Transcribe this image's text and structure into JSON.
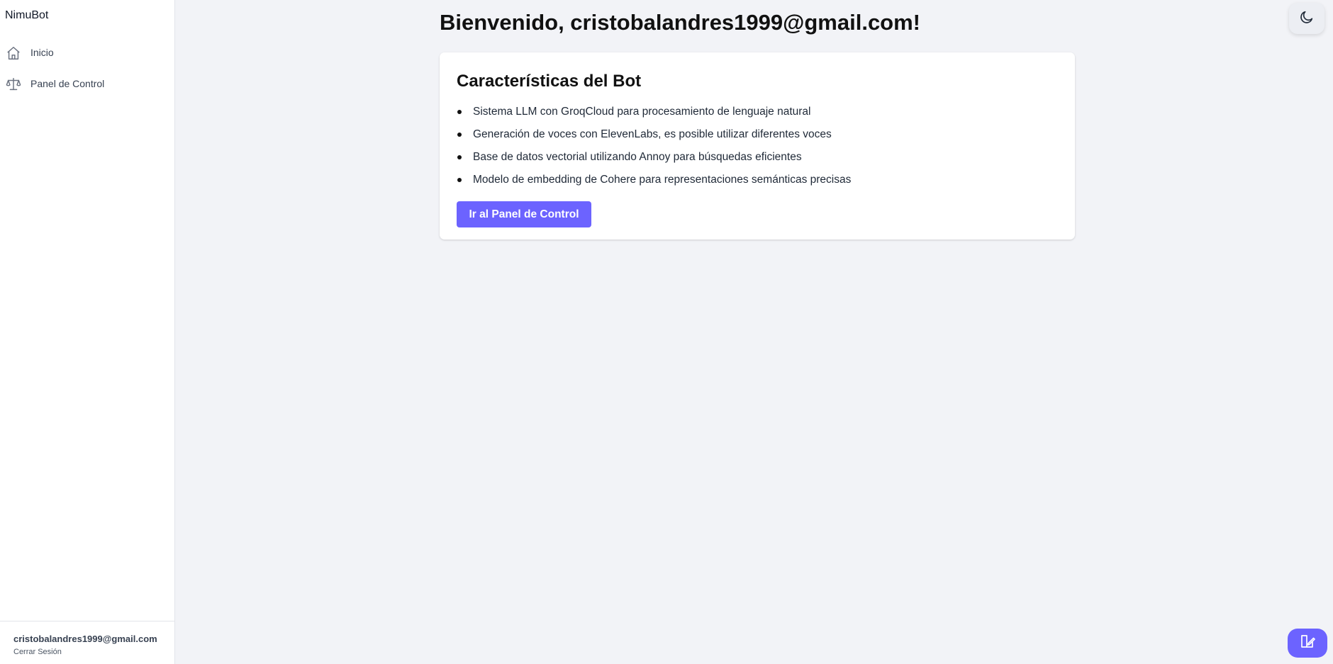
{
  "sidebar": {
    "brand": "NimuBot",
    "items": [
      {
        "label": "Inicio",
        "icon": "home-icon"
      },
      {
        "label": "Panel de Control",
        "icon": "scale-icon"
      }
    ],
    "footer": {
      "email": "cristobalandres1999@gmail.com",
      "logout": "Cerrar Sesión"
    }
  },
  "main": {
    "welcome": "Bienvenido, cristobalandres1999@gmail.com!",
    "card": {
      "title": "Características del Bot",
      "features": [
        "Sistema LLM con GroqCloud para procesamiento de lenguaje natural",
        "Generación de voces con ElevenLabs, es posible utilizar diferentes voces",
        "Base de datos vectorial utilizando Annoy para búsquedas eficientes",
        "Modelo de embedding de Cohere para representaciones semánticas precisas"
      ],
      "button": "Ir al Panel de Control"
    }
  },
  "floating": {
    "theme_toggle_icon": "moon-icon",
    "fab_icon": "book-edit-icon"
  },
  "colors": {
    "accent": "#6c63ff",
    "background": "#f2f3f7",
    "surface": "#ffffff"
  }
}
